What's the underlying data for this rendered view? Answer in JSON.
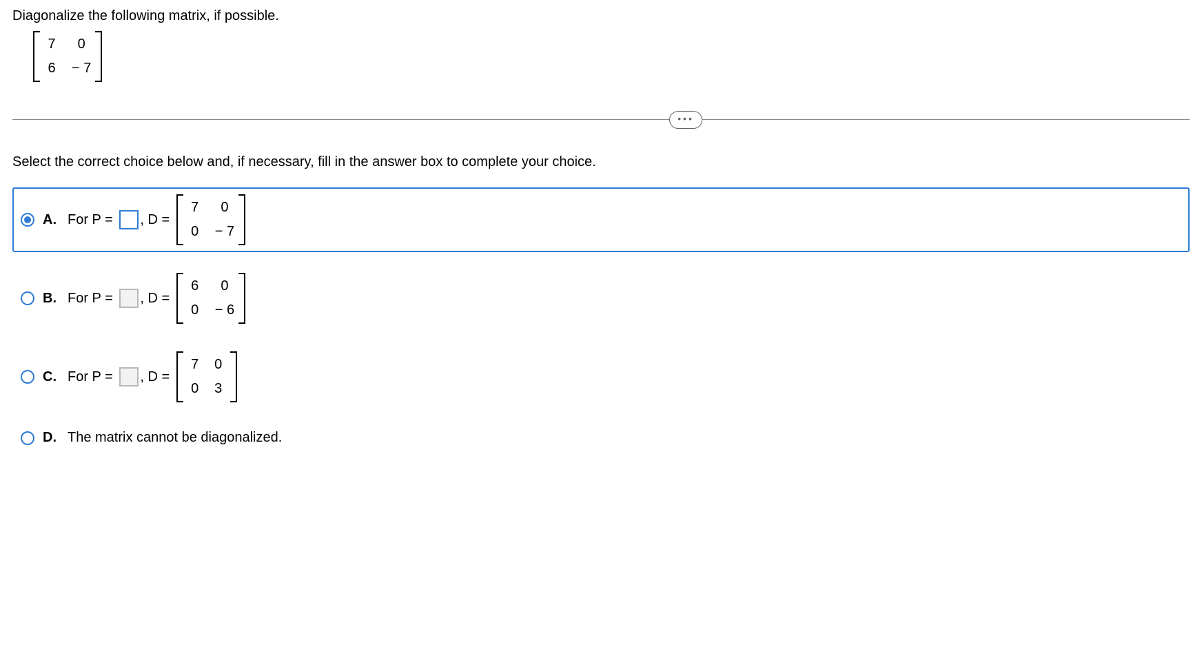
{
  "question": "Diagonalize the following matrix, if possible.",
  "given_matrix": {
    "a11": "7",
    "a12": "0",
    "a21": "6",
    "a22": "− 7"
  },
  "instruction": "Select the correct choice below and, if necessary, fill in the answer box to complete your choice.",
  "more_button": "•••",
  "choices": {
    "A": {
      "label": "A.",
      "prefix": "For P =",
      "mid": ", D =",
      "matrix": {
        "a11": "7",
        "a12": "0",
        "a21": "0",
        "a22": "− 7"
      }
    },
    "B": {
      "label": "B.",
      "prefix": "For P =",
      "mid": ", D =",
      "matrix": {
        "a11": "6",
        "a12": "0",
        "a21": "0",
        "a22": "− 6"
      }
    },
    "C": {
      "label": "C.",
      "prefix": "For P =",
      "mid": ", D =",
      "matrix": {
        "a11": "7",
        "a12": "0",
        "a21": "0",
        "a22": "3"
      }
    },
    "D": {
      "label": "D.",
      "text": "The matrix cannot be diagonalized."
    }
  }
}
